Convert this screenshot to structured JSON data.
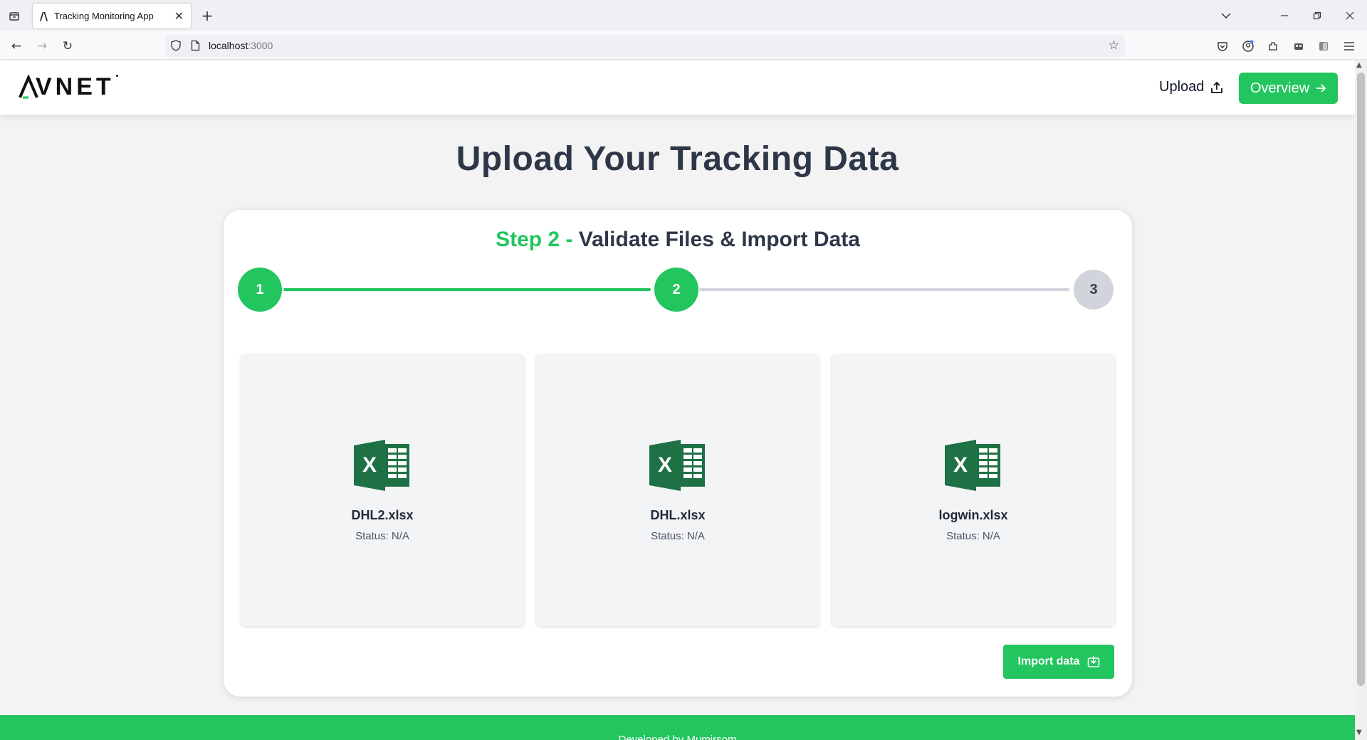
{
  "browser": {
    "tab_title": "Tracking Monitoring App",
    "tab_favicon": "/\\",
    "url_host": "localhost",
    "url_port": ":3000"
  },
  "header": {
    "logo_text": "VNET",
    "upload_label": "Upload",
    "overview_label": "Overview"
  },
  "main": {
    "title": "Upload Your Tracking Data",
    "step_prefix": "Step 2 - ",
    "step_title": "Validate Files & Import Data",
    "steps": [
      "1",
      "2",
      "3"
    ],
    "current_step": 2,
    "files": [
      {
        "name": "DHL2.xlsx",
        "status": "Status: N/A"
      },
      {
        "name": "DHL.xlsx",
        "status": "Status: N/A"
      },
      {
        "name": "logwin.xlsx",
        "status": "Status: N/A"
      }
    ],
    "import_label": "Import data"
  },
  "footer": {
    "text": "Developed by Mumirsom"
  },
  "colors": {
    "accent": "#22c55e",
    "excel": "#1e7145",
    "text_dark": "#2d3748"
  }
}
